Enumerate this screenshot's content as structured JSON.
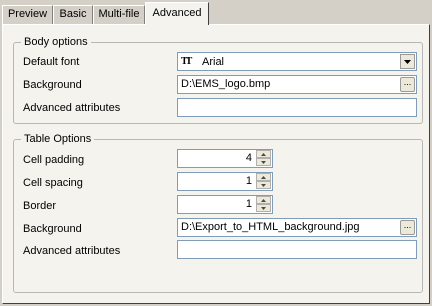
{
  "tabs": [
    {
      "label": "Preview"
    },
    {
      "label": "Basic"
    },
    {
      "label": "Multi-file"
    },
    {
      "label": "Advanced"
    }
  ],
  "body_options": {
    "title": "Body options",
    "default_font_label": "Default font",
    "default_font_value": "Arial",
    "font_icon": "truetype-font-icon",
    "background_label": "Background",
    "background_value": "D:\\EMS_logo.bmp",
    "advanced_attributes_label": "Advanced attributes",
    "advanced_attributes_value": ""
  },
  "table_options": {
    "title": "Table Options",
    "cell_padding_label": "Cell padding",
    "cell_padding_value": "4",
    "cell_spacing_label": "Cell spacing",
    "cell_spacing_value": "1",
    "border_label": "Border",
    "border_value": "1",
    "background_label": "Background",
    "background_value": "D:\\Export_to_HTML_background.jpg",
    "advanced_attributes_label": "Advanced attributes",
    "advanced_attributes_value": ""
  },
  "browse_button_label": "...",
  "colors": {
    "panel": "#f4f3ee",
    "window": "#d4d0c8",
    "field_border": "#7f9db9"
  }
}
